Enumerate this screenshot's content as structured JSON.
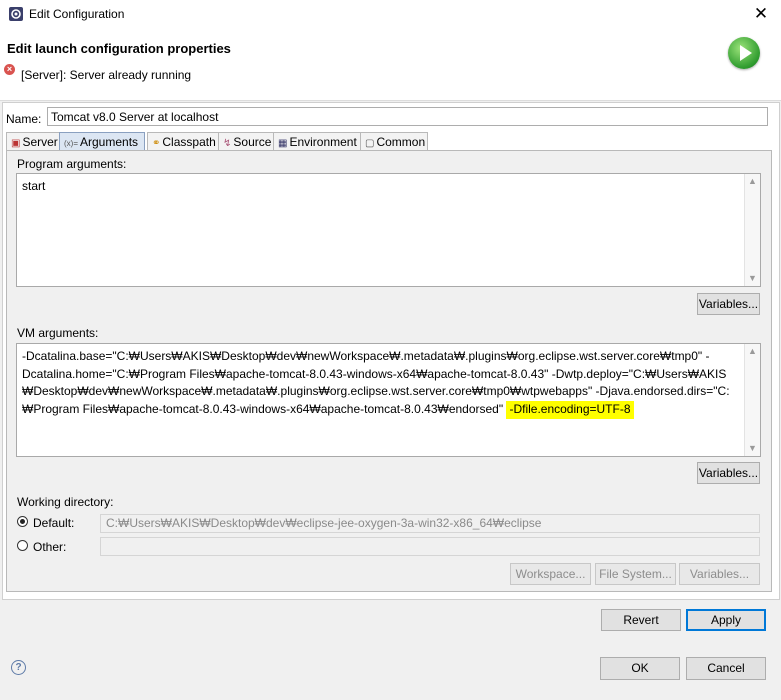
{
  "window": {
    "title": "Edit Configuration",
    "close_glyph": "✕"
  },
  "header": {
    "title": "Edit launch configuration properties",
    "error_message": "[Server]: Server already running"
  },
  "name": {
    "label": "Name:",
    "value": "Tomcat v8.0 Server at localhost"
  },
  "tabs": [
    {
      "label": "Server",
      "icon": "server-icon",
      "glyph": "▣"
    },
    {
      "label": "Arguments",
      "icon": "arguments-icon",
      "glyph": "(x)="
    },
    {
      "label": "Classpath",
      "icon": "classpath-icon",
      "glyph": "⚭"
    },
    {
      "label": "Source",
      "icon": "source-icon",
      "glyph": "↯"
    },
    {
      "label": "Environment",
      "icon": "environment-icon",
      "glyph": "▦"
    },
    {
      "label": "Common",
      "icon": "common-icon",
      "glyph": "▢"
    }
  ],
  "program_args": {
    "label": "Program arguments:",
    "value": "start",
    "variables_label": "Variables..."
  },
  "vm_args": {
    "label": "VM arguments:",
    "line1": "-Dcatalina.base=\"C:₩Users₩AKIS₩Desktop₩dev₩newWorkspace₩.metadata₩.plugins₩org.eclipse.wst.server.core₩tmp0\" -",
    "line2": "Dcatalina.home=\"C:₩Program Files₩apache-tomcat-8.0.43-windows-x64₩apache-tomcat-8.0.43\" -Dwtp.deploy=\"C:₩Users₩AKIS",
    "line3": "₩Desktop₩dev₩newWorkspace₩.metadata₩.plugins₩org.eclipse.wst.server.core₩tmp0₩wtpwebapps\" -Djava.endorsed.dirs=\"C:",
    "line4": "₩Program Files₩apache-tomcat-8.0.43-windows-x64₩apache-tomcat-8.0.43₩endorsed\" ",
    "highlight": "-Dfile.encoding=UTF-8",
    "highlight_color": "#ffff00",
    "variables_label": "Variables..."
  },
  "working_dir": {
    "label": "Working directory:",
    "default_label": "Default:",
    "default_value": "C:₩Users₩AKIS₩Desktop₩dev₩eclipse-jee-oxygen-3a-win32-x86_64₩eclipse",
    "other_label": "Other:",
    "other_value": "",
    "workspace_label": "Workspace...",
    "filesystem_label": "File System...",
    "variables_label": "Variables..."
  },
  "buttons": {
    "revert": "Revert",
    "apply": "Apply",
    "ok": "OK",
    "cancel": "Cancel",
    "help_glyph": "?"
  },
  "colors": {
    "error": "#d9534f",
    "run": "#2e9b2e",
    "focus": "#0078d7"
  }
}
